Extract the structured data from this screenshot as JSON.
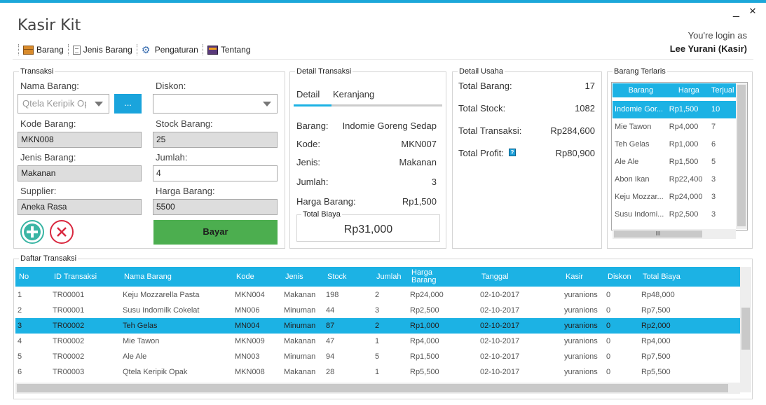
{
  "app": {
    "title": "Kasir Kit",
    "minimize": "_",
    "close": "×"
  },
  "login": {
    "label": "You're login as",
    "user": "Lee Yurani (Kasir)"
  },
  "menu": [
    {
      "label": "Barang",
      "icon": "box-icon"
    },
    {
      "label": "Jenis Barang",
      "icon": "list-icon"
    },
    {
      "label": "Pengaturan",
      "icon": "gears-icon"
    },
    {
      "label": "Tentang",
      "icon": "card-icon"
    }
  ],
  "transaksi": {
    "legend": "Transaksi",
    "nama_barang_label": "Nama Barang:",
    "nama_barang_value": "Qtela Keripik Opak",
    "browse_label": "...",
    "diskon_label": "Diskon:",
    "diskon_value": "",
    "kode_label": "Kode Barang:",
    "kode_value": "MKN008",
    "stock_label": "Stock Barang:",
    "stock_value": "25",
    "jenis_label": "Jenis Barang:",
    "jenis_value": "Makanan",
    "jumlah_label": "Jumlah:",
    "jumlah_value": "4",
    "supplier_label": "Supplier:",
    "supplier_value": "Aneka Rasa",
    "harga_label": "Harga Barang:",
    "harga_value": "5500",
    "bayar_label": "Bayar"
  },
  "detail_transaksi": {
    "legend": "Detail Transaksi",
    "tabs": [
      "Detail",
      "Keranjang"
    ],
    "rows": [
      {
        "label": "Barang:",
        "value": "Indomie Goreng Sedap"
      },
      {
        "label": "Kode:",
        "value": "MKN007"
      },
      {
        "label": "Jenis:",
        "value": "Makanan"
      },
      {
        "label": "Jumlah:",
        "value": "3"
      },
      {
        "label": "Harga Barang:",
        "value": "Rp1,500"
      }
    ],
    "total_label": "Total Biaya",
    "total_value": "Rp31,000"
  },
  "detail_usaha": {
    "legend": "Detail Usaha",
    "rows": [
      {
        "label": "Total Barang:",
        "value": "17"
      },
      {
        "label": "Total Stock:",
        "value": "1082"
      },
      {
        "label": "Total Transaksi:",
        "value": "Rp284,600"
      },
      {
        "label": "Total Profit:",
        "value": "Rp80,900"
      }
    ],
    "help_icon": "?"
  },
  "barang_terlaris": {
    "legend": "Barang Terlaris",
    "columns": [
      "Barang",
      "Harga",
      "Terjual"
    ],
    "rows": [
      [
        "Indomie Gor...",
        "Rp1,500",
        "10"
      ],
      [
        "Mie Tawon",
        "Rp4,000",
        "7"
      ],
      [
        "Teh Gelas",
        "Rp1,000",
        "6"
      ],
      [
        "Ale Ale",
        "Rp1,500",
        "5"
      ],
      [
        "Abon Ikan",
        "Rp22,400",
        "3"
      ],
      [
        "Keju Mozzar...",
        "Rp24,000",
        "3"
      ],
      [
        "Susu Indomi...",
        "Rp2,500",
        "3"
      ]
    ],
    "scroll_grip": "III"
  },
  "daftar_transaksi": {
    "legend": "Daftar Transaksi",
    "columns": [
      "No",
      "ID Transaksi",
      "Nama Barang",
      "Kode",
      "Jenis",
      "Stock",
      "Jumlah",
      "Harga Barang",
      "Tanggal",
      "Kasir",
      "Diskon",
      "Total Biaya"
    ],
    "rows": [
      [
        "1",
        "TR00001",
        "Keju Mozzarella Pasta",
        "MKN004",
        "Makanan",
        "198",
        "2",
        "Rp24,000",
        "02-10-2017",
        "yuranions",
        "0",
        "Rp48,000"
      ],
      [
        "2",
        "TR00001",
        "Susu Indomilk Cokelat",
        "MN006",
        "Minuman",
        "44",
        "3",
        "Rp2,500",
        "02-10-2017",
        "yuranions",
        "0",
        "Rp7,500"
      ],
      [
        "3",
        "TR00002",
        "Teh Gelas",
        "MN004",
        "Minuman",
        "87",
        "2",
        "Rp1,000",
        "02-10-2017",
        "yuranions",
        "0",
        "Rp2,000"
      ],
      [
        "4",
        "TR00002",
        "Mie Tawon",
        "MKN009",
        "Makanan",
        "47",
        "1",
        "Rp4,000",
        "02-10-2017",
        "yuranions",
        "0",
        "Rp4,000"
      ],
      [
        "5",
        "TR00002",
        "Ale Ale",
        "MN003",
        "Minuman",
        "94",
        "5",
        "Rp1,500",
        "02-10-2017",
        "yuranions",
        "0",
        "Rp7,500"
      ],
      [
        "6",
        "TR00003",
        "Qtela Keripik Opak",
        "MKN008",
        "Makanan",
        "28",
        "1",
        "Rp5,500",
        "02-10-2017",
        "yuranions",
        "0",
        "Rp5,500"
      ]
    ],
    "selected_index": 2
  },
  "colors": {
    "accent": "#1cb2e4",
    "bayar": "#4cae4f",
    "add": "#3ab5a4",
    "cancel": "#d9283f"
  }
}
